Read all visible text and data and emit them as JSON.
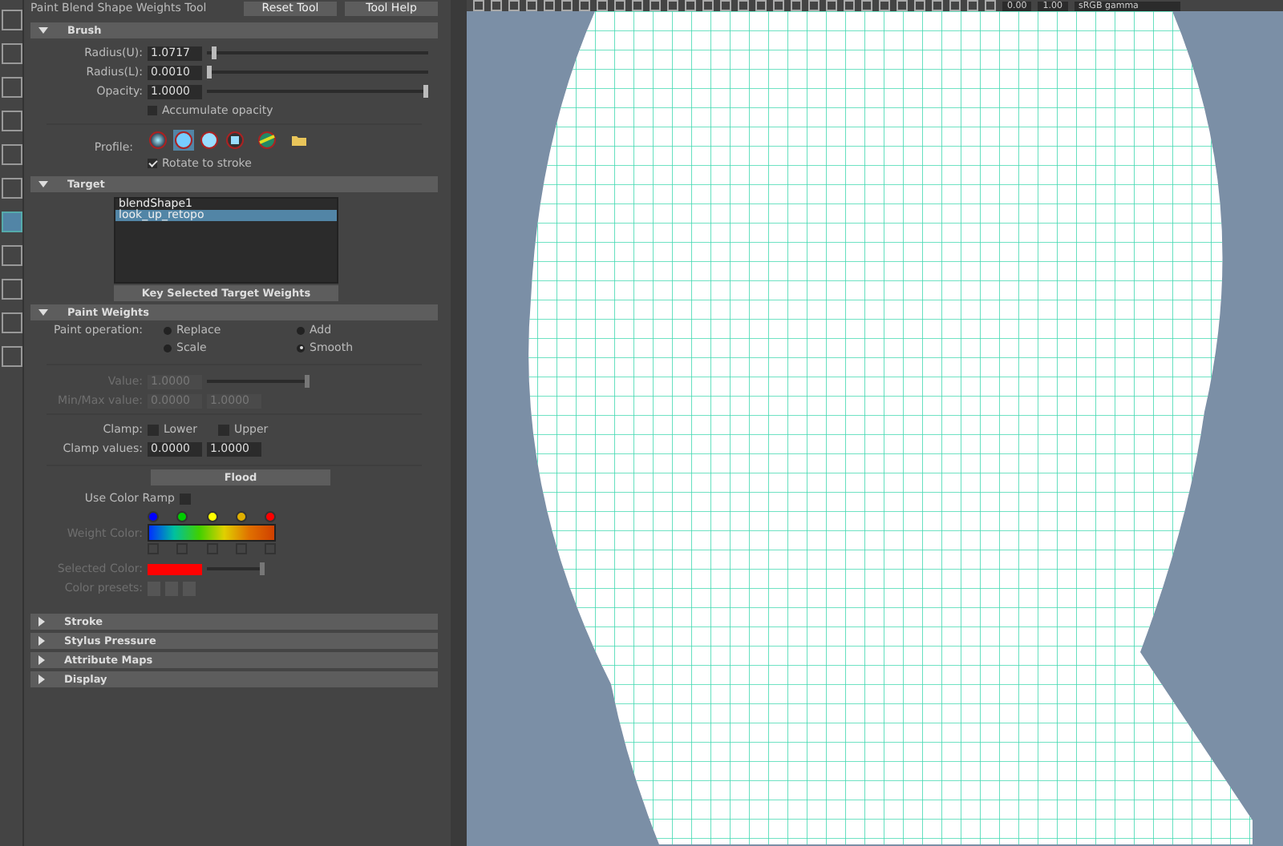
{
  "tool_title": "Paint Blend Shape Weights Tool",
  "header_buttons": [
    "Reset Tool",
    "Tool Help"
  ],
  "brush": {
    "title": "Brush",
    "expanded": true,
    "sliders": [
      {
        "label": "Radius(U):",
        "value": "1.0717",
        "level": 0.02
      },
      {
        "label": "Radius(L):",
        "value": "0.0010",
        "level": 0.0
      },
      {
        "label": "Opacity:",
        "value": "1.0000",
        "level": 1.0
      }
    ],
    "accumulate_opacity": {
      "label": "Accumulate opacity",
      "checked": false
    },
    "profile_label": "Profile:",
    "profiles": [
      {
        "kind": "soft",
        "selected": false
      },
      {
        "kind": "gaussian",
        "selected": true
      },
      {
        "kind": "solid",
        "selected": false
      },
      {
        "kind": "square",
        "selected": false
      },
      {
        "kind": "image",
        "selected": false
      },
      {
        "kind": "folder",
        "selected": false
      }
    ],
    "rotate_to_stroke": {
      "label": "Rotate to stroke",
      "checked": true
    }
  },
  "target": {
    "title": "Target",
    "expanded": true,
    "items": [
      {
        "label": "blendShape1",
        "selected": false
      },
      {
        "label": "look_up_retopo",
        "selected": true
      }
    ],
    "button": "Key Selected Target Weights"
  },
  "paint_weights": {
    "title": "Paint Weights",
    "expanded": true,
    "operation_label": "Paint operation:",
    "operations": [
      {
        "label": "Replace",
        "selected": false
      },
      {
        "label": "Add",
        "selected": false
      },
      {
        "label": "Scale",
        "selected": false
      },
      {
        "label": "Smooth",
        "selected": true
      }
    ],
    "value": {
      "label": "Value:",
      "value": "1.0000",
      "level": 1.0,
      "disabled": true
    },
    "minmax": {
      "label": "Min/Max value:",
      "min": "0.0000",
      "max": "1.0000",
      "disabled": true
    },
    "clamp_label": "Clamp:",
    "clamps": [
      {
        "label": "Lower",
        "checked": false
      },
      {
        "label": "Upper",
        "checked": false
      }
    ],
    "clamp_values_label": "Clamp values:",
    "clamp_min": "0.0000",
    "clamp_max": "1.0000",
    "flood": "Flood",
    "use_color_ramp": {
      "label": "Use Color Ramp",
      "checked": false
    },
    "weight_color_label": "Weight Color:",
    "ramp_stops": [
      {
        "color": "#0000ff"
      },
      {
        "color": "#00cc00"
      },
      {
        "color": "#ffff00"
      },
      {
        "color": "#e0b000"
      },
      {
        "color": "#ff0000"
      }
    ],
    "selected_color_label": "Selected Color:",
    "color_presets_label": "Color presets:"
  },
  "collapsed_sections": [
    {
      "title": "Stroke",
      "expanded": false
    },
    {
      "title": "Stylus Pressure",
      "expanded": false
    },
    {
      "title": "Attribute Maps",
      "expanded": false
    },
    {
      "title": "Display",
      "expanded": false
    }
  ],
  "viewport_toolbar": {
    "exposure": "0.00",
    "gamma": "1.00",
    "color_space": "sRGB gamma"
  }
}
